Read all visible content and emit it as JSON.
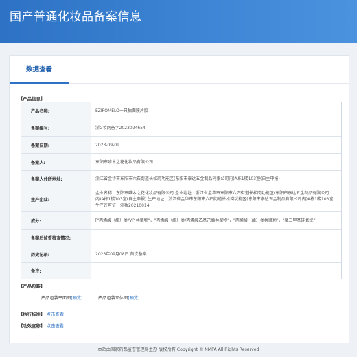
{
  "header": {
    "title": "国产普通化妆品备案信息"
  },
  "tabs": [
    {
      "label": "数据查看"
    }
  ],
  "product_info": {
    "section_title": "【产品信息】",
    "rows": [
      {
        "label": "产品名称:",
        "value": "EZIPOMELO一只柚面膜片胶"
      },
      {
        "label": "备案编号:",
        "value": "浙G妆网备字2023024654"
      },
      {
        "label": "备案日期:",
        "value": "2023-09-01"
      },
      {
        "label": "备案人:",
        "value": "东阳市唯木之花化妆品有限公司"
      },
      {
        "label": "备案人住所地址:",
        "value": "浙江省金华市东阳市六石街道长松岗功能区(东阳市泰达五金制品有限公司内)A栋1楼103室(自主申报)"
      },
      {
        "label": "生产企业:",
        "value": "企业名称：东阳市唯木之花化妆品有限公司 企业地址：浙江省金华市东阳市六石街道长松岗功能区(东阳市泰达五金制品有限公司内)A栋1楼103室(自主申报) 生产地址：浙江省金华市东阳市六石街道长松岗功能区(东阳市泰达五金制品有限公司内)A栋1楼103室 生产许可证：浙妆20210014"
      },
      {
        "label": "成分:",
        "value": "[\"丙烯酸（酯）类/VP 共聚物\"，\"丙烯酸（酯）类/丙烯酸乙基己酯共聚物\"，\"丙烯酸（酯）类共聚物\"，\"聚二甲基硅氧烷\"]"
      },
      {
        "label": "备案后监督检查情况:",
        "value": ""
      },
      {
        "label": "历史记录:",
        "value": "2023年09月08日 首次备案"
      },
      {
        "label": "备注:",
        "value": ""
      }
    ]
  },
  "packaging": {
    "section_title": "【产品包装】",
    "flat_label": "产品包装平面图",
    "flat_link": "[预览]",
    "stereo_label": "产品包装立体图",
    "stereo_link": "[预览]"
  },
  "standard": {
    "section_title": "【执行标准】",
    "link": "点击查看"
  },
  "efficacy": {
    "section_title": "【功效宣称】",
    "link": "点击查看"
  },
  "footer": {
    "text": "本站由国家药品监督管理局主办 版权所有 Copyright © NMPA All Rights Reserved"
  }
}
